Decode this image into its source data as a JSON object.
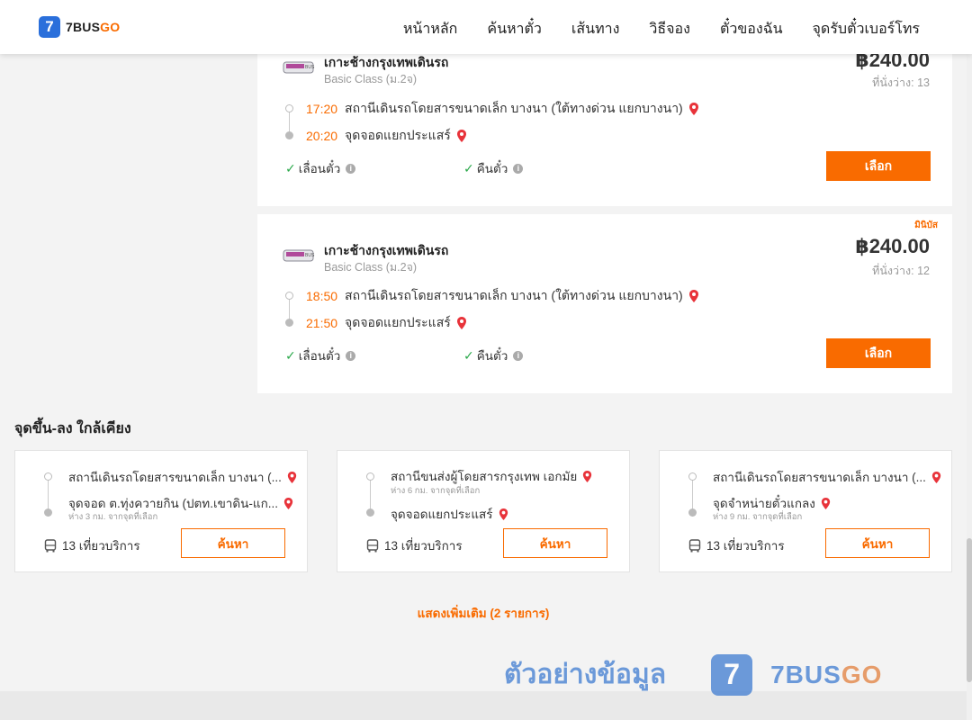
{
  "header": {
    "logo_num": "7",
    "logo_name": "7BUS",
    "logo_go": "GO",
    "nav": [
      "หน้าหลัก",
      "ค้นหาตั๋ว",
      "เส้นทาง",
      "วิธีจอง",
      "ตั๋วของฉัน",
      "จุดรับตั๋วเบอร์โทร"
    ]
  },
  "trips": [
    {
      "operator": "เกาะช้างกรุงเทพเดินรถ",
      "class": "Basic Class (ม.2จ)",
      "price": "฿240.00",
      "seats": "ที่นั่งว่าง: 13",
      "badge": "",
      "depart_time": "17:20",
      "depart_stop": "สถานีเดินรถโดยสารขนาดเล็ก บางนา (ใต้ทางด่วน แยกบางนา)",
      "arrive_time": "20:20",
      "arrive_stop": "จุดจอดแยกประแสร์",
      "reschedule": "เลื่อนตั๋ว",
      "refund": "คืนตั๋ว",
      "select_label": "เลือก"
    },
    {
      "operator": "เกาะช้างกรุงเทพเดินรถ",
      "class": "Basic Class (ม.2จ)",
      "price": "฿240.00",
      "seats": "ที่นั่งว่าง: 12",
      "badge": "มินิบัส",
      "depart_time": "18:50",
      "depart_stop": "สถานีเดินรถโดยสารขนาดเล็ก บางนา (ใต้ทางด่วน แยกบางนา)",
      "arrive_time": "21:50",
      "arrive_stop": "จุดจอดแยกประแสร์",
      "reschedule": "เลื่อนตั๋ว",
      "refund": "คืนตั๋ว",
      "select_label": "เลือก"
    }
  ],
  "nearby": {
    "title": "จุดขึ้น-ลง ใกล้เคียง",
    "cards": [
      {
        "from": "สถานีเดินรถโดยสารขนาดเล็ก บางนา (...",
        "to": "จุดจอด ต.ทุ่งควายกิน (ปตท.เขาดิน-แก...",
        "distance": "ห่าง 3 กม. จากจุดที่เลือก",
        "trips": "13 เที่ยวบริการ",
        "search_label": "ค้นหา"
      },
      {
        "from": "สถานีขนส่งผู้โดยสารกรุงเทพ เอกมัย",
        "from_distance": "ห่าง 6 กม. จากจุดที่เลือก",
        "to": "จุดจอดแยกประแสร์",
        "trips": "13 เที่ยวบริการ",
        "search_label": "ค้นหา"
      },
      {
        "from": "สถานีเดินรถโดยสารขนาดเล็ก บางนา (...",
        "to": "จุดจำหน่ายตั๋วแกลง",
        "distance": "ห่าง 9 กม. จากจุดที่เลือก",
        "trips": "13 เที่ยวบริการ",
        "search_label": "ค้นหา"
      }
    ],
    "show_more": "แสดงเพิ่มเติม (2 รายการ)"
  },
  "watermark": {
    "text": "ตัวอย่างข้อมูล",
    "mark": "7",
    "brand": "7BUS",
    "brand_go": "GO"
  },
  "colors": {
    "accent": "#f96b00",
    "brand_blue": "#2a6fdb",
    "check_green": "#2aa84a",
    "pin_red": "#e8333a"
  }
}
